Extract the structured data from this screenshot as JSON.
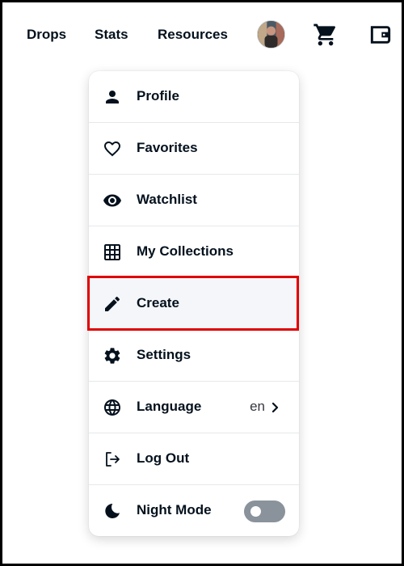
{
  "nav": {
    "links": [
      "Drops",
      "Stats",
      "Resources"
    ],
    "avatar_icon": "user-avatar",
    "cart_icon": "shopping-cart-icon",
    "wallet_icon": "wallet-icon"
  },
  "menu": {
    "items": [
      {
        "label": "Profile",
        "icon": "person-icon"
      },
      {
        "label": "Favorites",
        "icon": "heart-icon"
      },
      {
        "label": "Watchlist",
        "icon": "eye-icon"
      },
      {
        "label": "My Collections",
        "icon": "grid-icon"
      },
      {
        "label": "Create",
        "icon": "pencil-icon",
        "highlighted": true
      },
      {
        "label": "Settings",
        "icon": "gear-icon"
      },
      {
        "label": "Language",
        "icon": "globe-icon",
        "value": "en"
      },
      {
        "label": "Log Out",
        "icon": "logout-icon"
      },
      {
        "label": "Night Mode",
        "icon": "moon-icon",
        "toggle": false
      }
    ]
  },
  "colors": {
    "text": "#04111d",
    "divider": "#e5e8eb",
    "highlight": "#e00000",
    "toggle_off": "#8a939b"
  }
}
